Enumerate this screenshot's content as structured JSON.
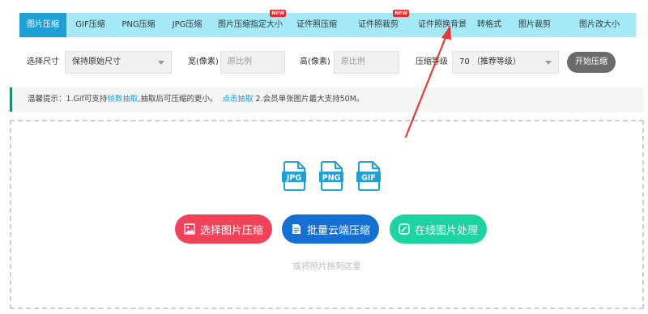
{
  "tabs": [
    {
      "label": "图片压缩",
      "active": true,
      "is_new": false
    },
    {
      "label": "GIF压缩",
      "active": false,
      "is_new": false
    },
    {
      "label": "PNG压缩",
      "active": false,
      "is_new": false
    },
    {
      "label": "JPG压缩",
      "active": false,
      "is_new": false
    },
    {
      "label": "图片压缩指定大小",
      "active": false,
      "is_new": true
    },
    {
      "label": "证件照压缩",
      "active": false,
      "is_new": false
    },
    {
      "label": "证件照裁剪",
      "active": false,
      "is_new": true
    },
    {
      "label": "证件照换背景",
      "active": false,
      "is_new": false
    },
    {
      "label": "转格式",
      "active": false,
      "is_new": false
    },
    {
      "label": "图片裁剪",
      "active": false,
      "is_new": false
    },
    {
      "label": "图片改大小",
      "active": false,
      "is_new": false
    }
  ],
  "new_badge": "NEW",
  "settings": {
    "size_label": "选择尺寸",
    "size_value": "保持原始尺寸",
    "width_label": "宽(像素)",
    "width_placeholder": "原比例",
    "height_label": "高(像素)",
    "height_placeholder": "原比例",
    "level_label": "压缩等级",
    "level_value": "70 （推荐等级）",
    "start_button": "开始压缩"
  },
  "tip": {
    "prefix": "温馨提示：1.Gif可支持",
    "link1": "帧数抽取",
    "middle": ",抽取后可压缩的更小。",
    "link2": "点击抽取",
    "suffix": " 2.会员单张图片最大支持50M。"
  },
  "file_types": [
    "JPG",
    "PNG",
    "GIF"
  ],
  "actions": [
    {
      "label": "选择图片压缩",
      "color": "#f0435a",
      "icon": "image-icon"
    },
    {
      "label": "批量云端压缩",
      "color": "#1670d4",
      "icon": "batch-doc-icon"
    },
    {
      "label": "在线图片处理",
      "color": "#1ed3a2",
      "icon": "online-edit-icon"
    }
  ],
  "drop_hint": "或将照片拖到这里",
  "colors": {
    "tabbar_bg": "#a6e9f6",
    "tab_active": "#1e9fd6",
    "new_badge": "#e8292e",
    "file_icon": "#1e9fd6",
    "arrow": "#e53935"
  }
}
